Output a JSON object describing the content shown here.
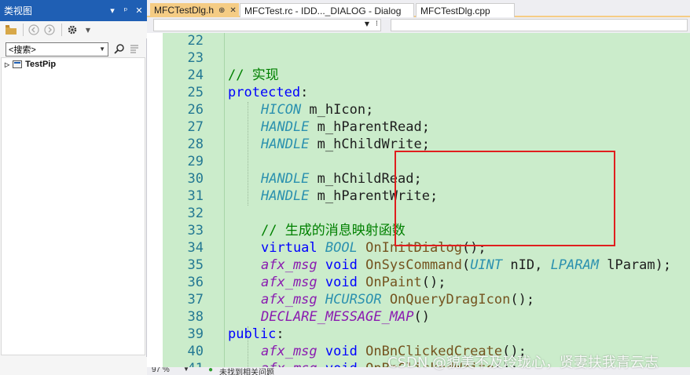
{
  "class_view": {
    "title": "类视图",
    "title_buttons": [
      "▾",
      "ᵖ",
      "✕"
    ],
    "search_placeholder": "<搜索>",
    "tree_root": "TestPip"
  },
  "tabs": [
    {
      "label": "MFCTestDlg.h",
      "pin": "⊕",
      "close": "✕",
      "active": true
    },
    {
      "label": "MFCTest.rc - IDD..._DIALOG - Dialog",
      "active": false
    },
    {
      "label": "MFCTestDlg.cpp",
      "active": false
    }
  ],
  "editor": {
    "lines": [
      {
        "n": "22",
        "indent": 0,
        "parts": []
      },
      {
        "n": "23",
        "indent": 0,
        "parts": []
      },
      {
        "n": "24",
        "indent": 0,
        "parts": [
          {
            "t": "// 实现",
            "c": "cm"
          }
        ]
      },
      {
        "n": "25",
        "indent": 0,
        "parts": [
          {
            "t": "protected",
            "c": "kw"
          },
          {
            "t": ":",
            "c": "pn"
          }
        ]
      },
      {
        "n": "26",
        "indent": 1,
        "parts": [
          {
            "t": "HICON",
            "c": "ty"
          },
          {
            "t": " m_hIcon;",
            "c": "pn"
          }
        ]
      },
      {
        "n": "27",
        "indent": 1,
        "parts": [
          {
            "t": "HANDLE",
            "c": "ty"
          },
          {
            "t": " m_hParentRead;",
            "c": "pn"
          }
        ]
      },
      {
        "n": "28",
        "indent": 1,
        "parts": [
          {
            "t": "HANDLE",
            "c": "ty"
          },
          {
            "t": " m_hChildWrite;",
            "c": "pn"
          }
        ]
      },
      {
        "n": "29",
        "indent": 0,
        "parts": []
      },
      {
        "n": "30",
        "indent": 1,
        "parts": [
          {
            "t": "HANDLE",
            "c": "ty"
          },
          {
            "t": " m_hChildRead;",
            "c": "pn"
          }
        ]
      },
      {
        "n": "31",
        "indent": 1,
        "parts": [
          {
            "t": "HANDLE",
            "c": "ty"
          },
          {
            "t": " m_hParentWrite;",
            "c": "pn"
          }
        ]
      },
      {
        "n": "32",
        "indent": 0,
        "parts": []
      },
      {
        "n": "33",
        "indent": 1,
        "parts": [
          {
            "t": "// 生成的消息映射函数",
            "c": "cm"
          }
        ]
      },
      {
        "n": "34",
        "indent": 1,
        "parts": [
          {
            "t": "virtual",
            "c": "kw"
          },
          {
            "t": " ",
            "c": "pn"
          },
          {
            "t": "BOOL",
            "c": "ty"
          },
          {
            "t": " ",
            "c": "pn"
          },
          {
            "t": "OnInitDialog",
            "c": "fn"
          },
          {
            "t": "();",
            "c": "pn"
          }
        ]
      },
      {
        "n": "35",
        "indent": 1,
        "parts": [
          {
            "t": "afx_msg",
            "c": "mac"
          },
          {
            "t": " ",
            "c": "pn"
          },
          {
            "t": "void",
            "c": "kw"
          },
          {
            "t": " ",
            "c": "pn"
          },
          {
            "t": "OnSysCommand",
            "c": "fn"
          },
          {
            "t": "(",
            "c": "pn"
          },
          {
            "t": "UINT",
            "c": "ty"
          },
          {
            "t": " nID, ",
            "c": "pn"
          },
          {
            "t": "LPARAM",
            "c": "ty"
          },
          {
            "t": " lParam);",
            "c": "pn"
          }
        ]
      },
      {
        "n": "36",
        "indent": 1,
        "parts": [
          {
            "t": "afx_msg",
            "c": "mac"
          },
          {
            "t": " ",
            "c": "pn"
          },
          {
            "t": "void",
            "c": "kw"
          },
          {
            "t": " ",
            "c": "pn"
          },
          {
            "t": "OnPaint",
            "c": "fn"
          },
          {
            "t": "();",
            "c": "pn"
          }
        ]
      },
      {
        "n": "37",
        "indent": 1,
        "parts": [
          {
            "t": "afx_msg",
            "c": "mac"
          },
          {
            "t": " ",
            "c": "pn"
          },
          {
            "t": "HCURSOR",
            "c": "ty"
          },
          {
            "t": " ",
            "c": "pn"
          },
          {
            "t": "OnQueryDragIcon",
            "c": "fn"
          },
          {
            "t": "();",
            "c": "pn"
          }
        ]
      },
      {
        "n": "38",
        "indent": 1,
        "parts": [
          {
            "t": "DECLARE_MESSAGE_MAP",
            "c": "mac"
          },
          {
            "t": "()",
            "c": "pn"
          }
        ]
      },
      {
        "n": "39",
        "indent": 0,
        "parts": [
          {
            "t": "public",
            "c": "kw"
          },
          {
            "t": ":",
            "c": "pn"
          }
        ]
      },
      {
        "n": "40",
        "indent": 1,
        "parts": [
          {
            "t": "afx_msg",
            "c": "mac"
          },
          {
            "t": " ",
            "c": "pn"
          },
          {
            "t": "void",
            "c": "kw"
          },
          {
            "t": " ",
            "c": "pn"
          },
          {
            "t": "OnBnClickedCreate",
            "c": "fn"
          },
          {
            "t": "();",
            "c": "pn"
          }
        ]
      },
      {
        "n": "41",
        "indent": 1,
        "parts": [
          {
            "t": "afx_msg",
            "c": "mac"
          },
          {
            "t": " ",
            "c": "pn"
          },
          {
            "t": "void",
            "c": "kw"
          },
          {
            "t": " ",
            "c": "pn"
          },
          {
            "t": "OnBnClickedWrite",
            "c": "fn"
          },
          {
            "t": "();",
            "c": "pn"
          }
        ]
      }
    ]
  },
  "status": {
    "zoom": "97 %",
    "message": "未找到相关问题"
  },
  "watermark": "CSDN @貌美不及玲珑心，贤妻扶我青云志",
  "colors": {
    "accent_blue": "#1f5fb4",
    "active_tab": "#f5cc84",
    "editor_bg": "#cbeccb",
    "highlight_box": "#e01e1e"
  }
}
